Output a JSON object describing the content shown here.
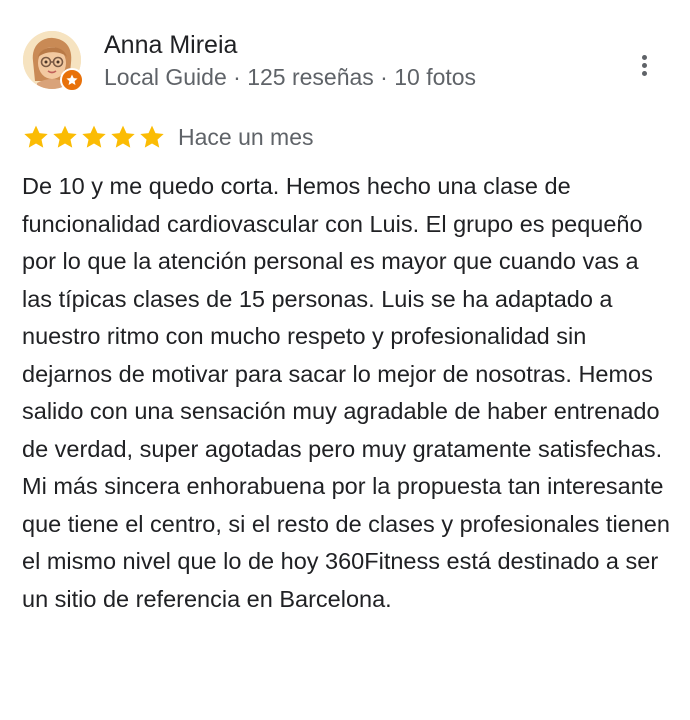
{
  "reviewer": {
    "name": "Anna Mireia",
    "meta": "Local Guide · 125 reseñas · 10 fotos",
    "avatar_icon": "memoji-avatar",
    "badge_icon": "local-guide-star-icon",
    "badge_color": "#e8710a"
  },
  "menu": {
    "icon": "more-vert-icon"
  },
  "rating": {
    "stars": 5,
    "max": 5,
    "star_color": "#fbbc04"
  },
  "date": "Hace un mes",
  "text": "De 10 y me quedo corta. Hemos hecho una clase de funcionalidad cardiovascular con Luis. El grupo es pequeño por lo que la atención personal es mayor que cuando vas a las típicas clases de 15 personas. Luis se ha adaptado a nuestro ritmo con mucho respeto y profesionalidad sin dejarnos de motivar para sacar lo mejor de nosotras. Hemos salido con una sensación muy agradable de haber entrenado de verdad, super agotadas pero muy gratamente satisfechas. Mi más sincera enhorabuena por la propuesta tan interesante que tiene el centro, si el resto de clases y profesionales tienen el mismo nivel que lo de hoy 360Fitness está destinado a ser un sitio de referencia en Barcelona."
}
